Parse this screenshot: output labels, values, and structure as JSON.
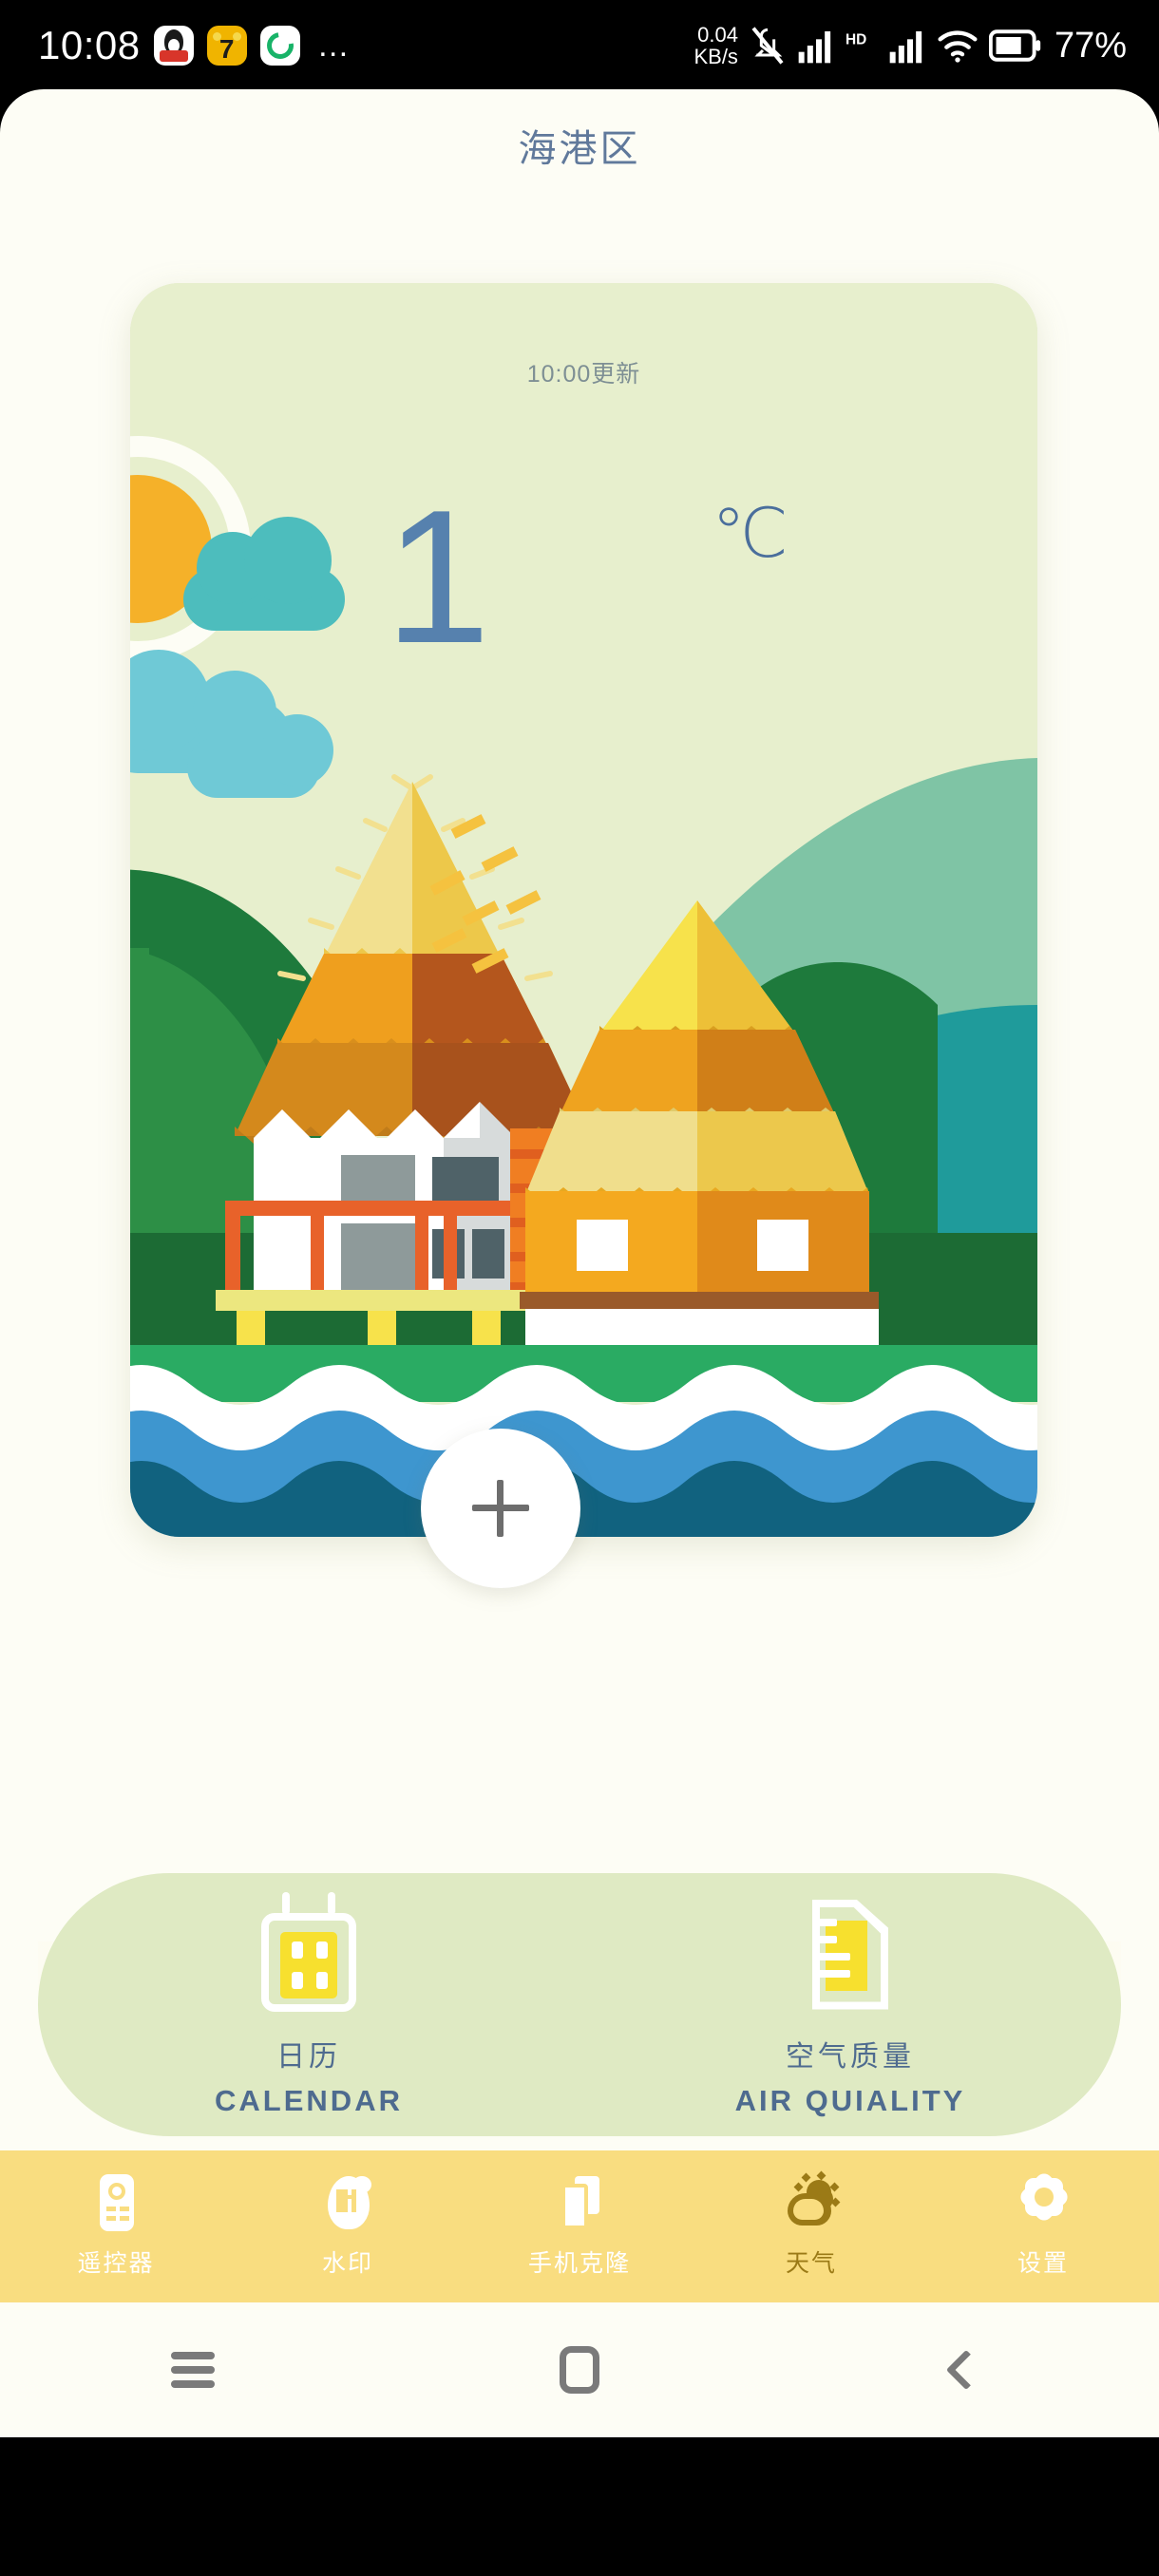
{
  "status_bar": {
    "clock": "10:08",
    "apps": [
      "qq-icon",
      "cat7-icon",
      "spiral-icon"
    ],
    "overflow": "…",
    "net_speed_value": "0.04",
    "net_speed_unit": "KB/s",
    "icons": [
      "mute-icon",
      "signal-1-icon",
      "hd-icon",
      "signal-2-icon",
      "wifi-icon",
      "battery-icon"
    ],
    "hd_label": "HD",
    "battery": "77%"
  },
  "header": {
    "title": "海港区"
  },
  "weather_card": {
    "update_text": "10:00更新",
    "temperature": "1",
    "unit": "℃",
    "add_button_icon": "plus-icon",
    "scene": {
      "illustration": "tropical-stilt-village",
      "colors": {
        "card_bg": "#e7efcd",
        "sun": "#f5b129",
        "sun_ring": "#fdfdf5",
        "cloud_teal": "#4dbdbd",
        "cloud_light": "#6fc9d6",
        "hill_dark": "#1e7a3c",
        "hill_mid": "#2d8f46",
        "hill_light": "#7fc4a5",
        "hill_teal": "#1f9b9b",
        "roof_light": "#f2e08f",
        "roof_yellow": "#edc84a",
        "roof_orange": "#ef9f1e",
        "roof_brown": "#b4561d",
        "roof_shadow": "#c9761c",
        "wall_white": "#ffffff",
        "wall_grey": "#8e9a9a",
        "window_dark": "#4f6268",
        "stilt_orange": "#e8622a",
        "water_grass": "#2aab63",
        "water_foam": "#ffffff",
        "water_blue": "#3e96cf",
        "water_deep": "#11627f"
      }
    }
  },
  "shortcuts": [
    {
      "icon": "calendar-icon",
      "label_cn": "日历",
      "label_en": "CALENDAR"
    },
    {
      "icon": "document-icon",
      "label_cn": "空气质量",
      "label_en": "AIR QUIALITY"
    }
  ],
  "tabbar": {
    "accent": "#f9dd80",
    "active_color": "#9b7a16",
    "inactive_color": "#ffffff",
    "items": [
      {
        "icon": "remote-control-icon",
        "label": "遥控器",
        "active": false
      },
      {
        "icon": "watermark-icon",
        "label": "水印",
        "active": false
      },
      {
        "icon": "phone-clone-icon",
        "label": "手机克隆",
        "active": false
      },
      {
        "icon": "weather-icon",
        "label": "天气",
        "active": true
      },
      {
        "icon": "settings-gear-icon",
        "label": "设置",
        "active": false
      }
    ]
  },
  "android_nav": {
    "items": [
      {
        "icon": "menu-icon",
        "label": "Recents"
      },
      {
        "icon": "home-icon",
        "label": "Home"
      },
      {
        "icon": "back-icon",
        "label": "Back"
      }
    ]
  }
}
